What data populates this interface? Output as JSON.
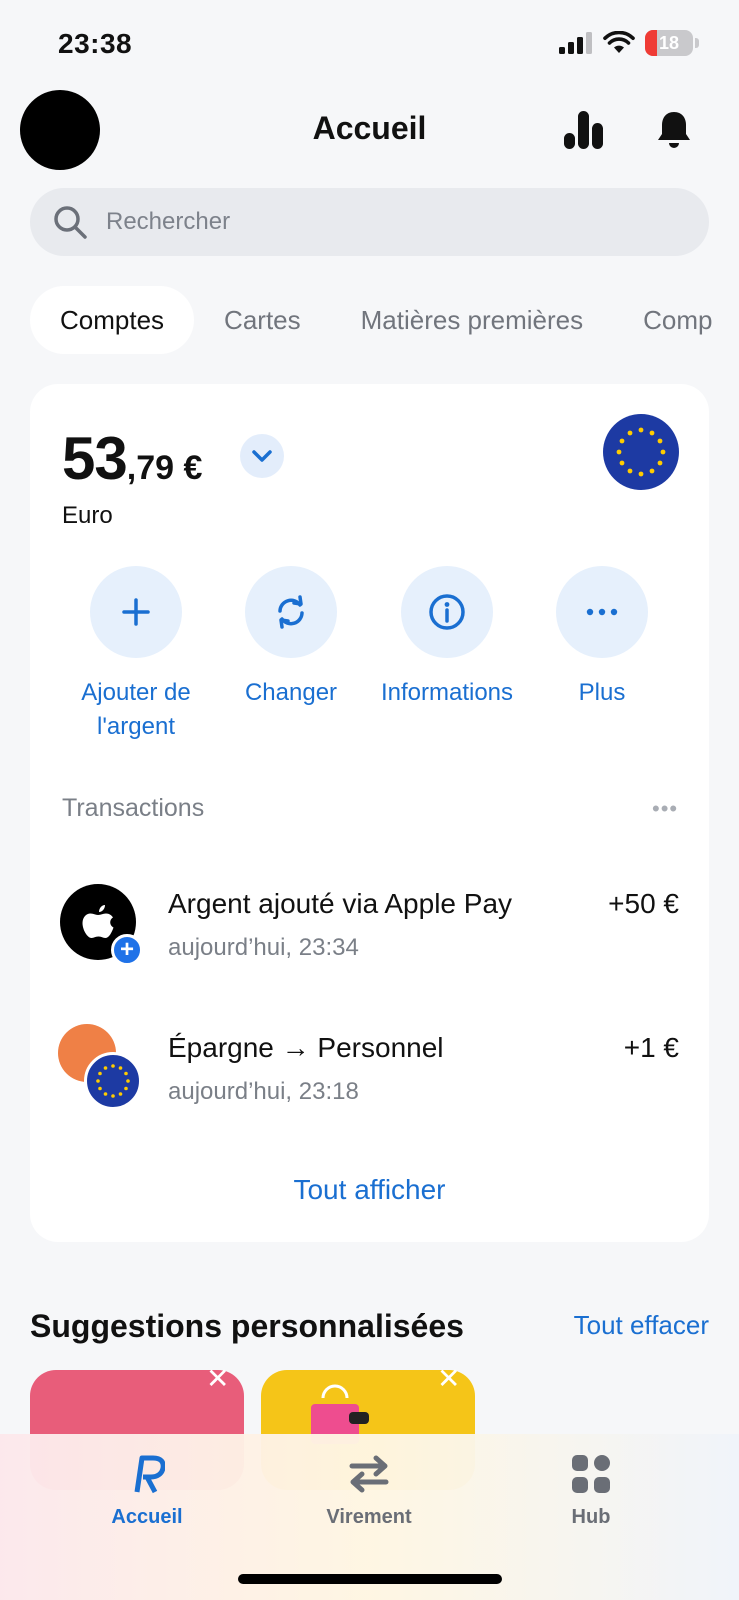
{
  "status_bar": {
    "time": "23:38",
    "battery": "18"
  },
  "header": {
    "title": "Accueil"
  },
  "search": {
    "placeholder": "Rechercher"
  },
  "tabs": [
    {
      "label": "Comptes",
      "active": true
    },
    {
      "label": "Cartes"
    },
    {
      "label": "Matières premières"
    },
    {
      "label": "Comp"
    }
  ],
  "account": {
    "balance_int": "53",
    "balance_dec": ",79 €",
    "currency": "Euro",
    "actions": [
      {
        "icon": "plus-icon",
        "label_line1": "Ajouter de",
        "label_line2": "l'argent"
      },
      {
        "icon": "exchange-icon",
        "label_line1": "Changer",
        "label_line2": ""
      },
      {
        "icon": "info-icon",
        "label_line1": "Informations",
        "label_line2": ""
      },
      {
        "icon": "more-icon",
        "label_line1": "Plus",
        "label_line2": ""
      }
    ]
  },
  "transactions": {
    "heading": "Transactions",
    "items": [
      {
        "title": "Argent ajouté via Apple Pay",
        "subtitle": "aujourd’hui, 23:34",
        "amount": "+50 €"
      },
      {
        "title": "Épargne → Personnel",
        "subtitle": "aujourd’hui, 23:18",
        "amount": "+1 €"
      }
    ],
    "see_all": "Tout afficher"
  },
  "suggestions": {
    "title": "Suggestions personnalisées",
    "clear": "Tout effacer"
  },
  "bottom_nav": [
    {
      "label": "Accueil",
      "active": true
    },
    {
      "label": "Virement"
    },
    {
      "label": "Hub"
    }
  ],
  "colors": {
    "accent": "#1a6fd1",
    "eu_blue": "#1d3aa3"
  }
}
